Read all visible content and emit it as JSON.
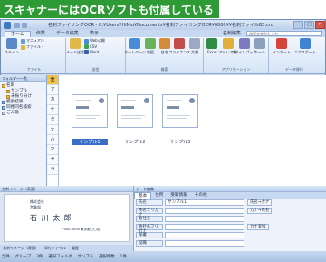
{
  "banner": {
    "text": "スキャナーにはOCRソフトも付属している"
  },
  "window": {
    "title": "名刺ファイリングOCR - C:¥Users¥HiNiu¥Documents¥名刺ファイリングOCR¥0000¥¥名刺ファイルBS.crd",
    "close": "✕",
    "maximize": "□",
    "minimize": "—"
  },
  "menu_tabs": [
    "ホーム",
    "作業",
    "データ編集",
    "表示",
    "名刺編集"
  ],
  "search": {
    "placeholder": "検索文字列を入力"
  },
  "ribbon": {
    "groups": [
      {
        "name": "ファイル",
        "big": [
          "スキャン",
          "メール送信"
        ],
        "small": [
          "マニュアル",
          "ファイル・"
        ]
      },
      {
        "name": "送信",
        "small": [
          "Web公開",
          "CSV",
          "Word",
          "送付状"
        ]
      },
      {
        "name": "検索",
        "big": [
          "ホームページ",
          "地図",
          "自宅",
          "ファイナンス",
          "文書"
        ]
      },
      {
        "name": "アプリケーション",
        "big": [
          "Excel",
          "アドレス帳",
          "スタイルブック",
          "ツール"
        ]
      },
      {
        "name": "データ移行",
        "big": [
          "インポート",
          "エクスポート"
        ]
      }
    ]
  },
  "folder_pane": {
    "title": "フォルダー一覧",
    "items": [
      "名刺",
      "サンプル",
      "未振り分け",
      "検索結果",
      "同姓同名検索",
      "ごみ箱"
    ]
  },
  "kana_index": [
    "全",
    "ア",
    "カ",
    "サ",
    "タ",
    "ナ",
    "ハ",
    "マ",
    "ヤ",
    "ラ",
    "ワ",
    "英",
    "他"
  ],
  "thumbnails": [
    "サンプル1",
    "サンプル2",
    "サンプル3"
  ],
  "image_pane": {
    "title": "名刺イメージ（表面）",
    "tabs": [
      "名刺イメージ（表面）",
      "添付ファイル",
      "履歴"
    ],
    "card": {
      "company": "株式会社",
      "dept": "営業部",
      "name": "石 川 太 郎",
      "address": "〒000-0000 東京都〇〇区"
    }
  },
  "data_pane": {
    "title": "データ編集",
    "tabs": [
      "基本",
      "住所",
      "受取情報",
      "その他"
    ],
    "rows": [
      {
        "label": "氏名",
        "value": "サンプル1",
        "action": "氏名→カナ"
      },
      {
        "label": "氏名フリガナ",
        "value": "",
        "action": "カナ→氏名"
      },
      {
        "label": "会社名",
        "value": "",
        "action": ""
      },
      {
        "label": "会社名フリガナ",
        "value": "",
        "action": "カナ変換"
      },
      {
        "label": "部署",
        "value": "",
        "action": ""
      },
      {
        "label": "役職",
        "value": "",
        "action": ""
      },
      {
        "label": "〒",
        "value": "",
        "action": "〒→住所"
      },
      {
        "label": "住所",
        "value": "",
        "action": ""
      }
    ]
  },
  "statusbar": [
    "全件",
    "グループ",
    "3件",
    "選択フォルダ",
    "サンプル",
    "選択件数",
    "1件"
  ]
}
